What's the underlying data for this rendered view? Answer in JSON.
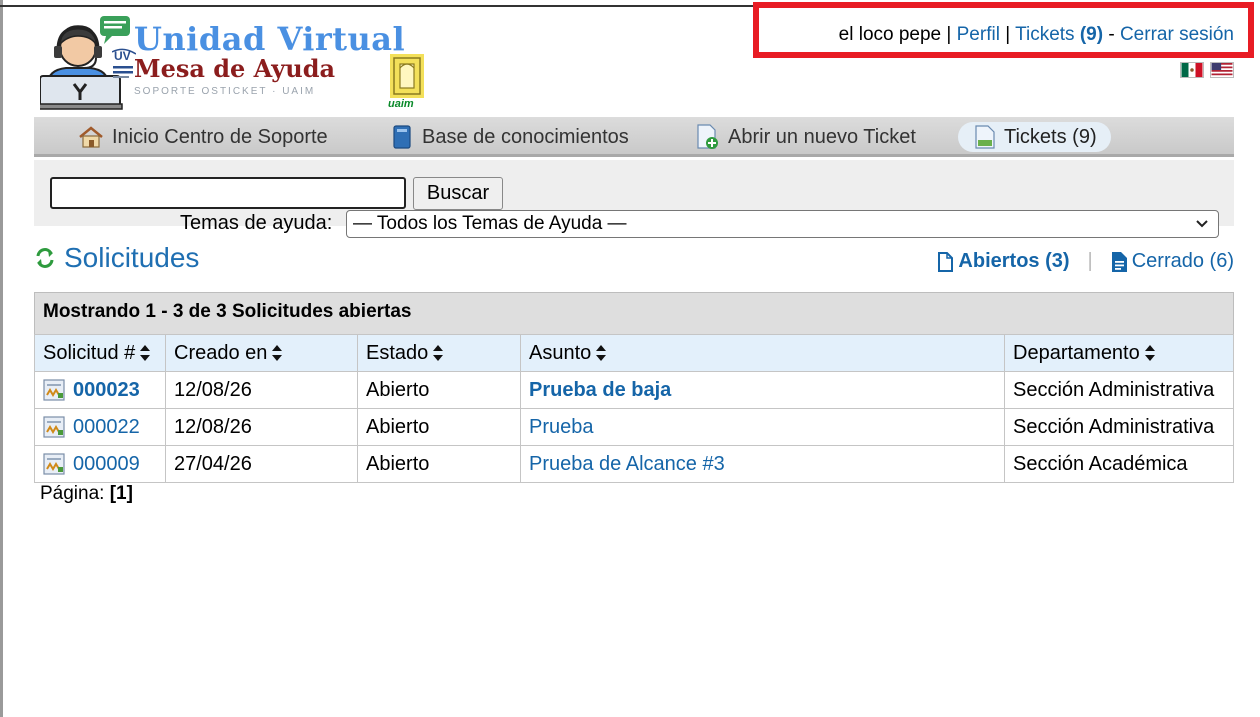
{
  "header": {
    "logo_title": "Unidad Virtual",
    "logo_subtitle": "Mesa de Ayuda",
    "logo_tagline": "SOPORTE OSTICKET · UAIM",
    "uaim_label": "uaim",
    "user_name": "el loco pepe",
    "sep1": "|",
    "profile_link": "Perfil",
    "sep2": "|",
    "tickets_link": "Tickets",
    "tickets_count": "(9)",
    "dash": "-",
    "logout_link": "Cerrar sesión",
    "flags": [
      "mexico-flag-icon",
      "usa-flag-icon"
    ]
  },
  "nav": {
    "items": [
      {
        "label": "Inicio Centro de Soporte",
        "icon": "home-icon"
      },
      {
        "label": "Base de conocimientos",
        "icon": "book-icon"
      },
      {
        "label": "Abrir un nuevo Ticket",
        "icon": "new-ticket-icon"
      },
      {
        "label": "Tickets (9)",
        "icon": "tickets-icon",
        "active": true
      }
    ]
  },
  "search": {
    "input_value": "",
    "button_label": "Buscar",
    "topics_label": "Temas de ayuda:",
    "topics_selected": "— Todos los Temas de Ayuda —"
  },
  "section": {
    "title": "Solicitudes",
    "open_filter": "Abiertos (3)",
    "closed_filter": "Cerrado (6)",
    "filter_sep": "|"
  },
  "table": {
    "caption": "Mostrando 1 - 3 de 3 Solicitudes abiertas",
    "columns": [
      "Solicitud #",
      "Creado en",
      "Estado",
      "Asunto",
      "Departamento"
    ],
    "rows": [
      {
        "number": "000023",
        "created": "12/08/26",
        "status": "Abierto",
        "subject": "Prueba de baja",
        "department": "Sección Administrativa"
      },
      {
        "number": "000022",
        "created": "12/08/26",
        "status": "Abierto",
        "subject": "Prueba",
        "department": "Sección Administrativa"
      },
      {
        "number": "000009",
        "created": "27/04/26",
        "status": "Abierto",
        "subject": "Prueba de Alcance #3",
        "department": "Sección Académica"
      }
    ]
  },
  "pager": {
    "label": "Página:",
    "current": "[1]"
  },
  "colors": {
    "link": "#1565a8",
    "highlight_border": "#e81c24",
    "header_row": "#e3f0fb",
    "title_blue": "#1f6fb2"
  }
}
